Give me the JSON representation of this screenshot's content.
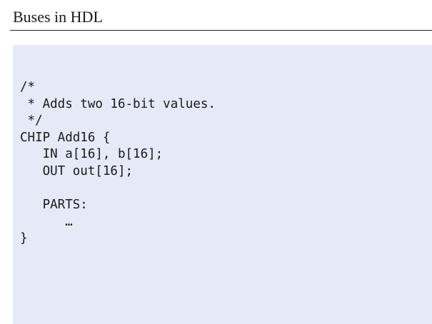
{
  "slide": {
    "title": "Buses in HDL"
  },
  "code": {
    "lines": [
      "/*",
      " * Adds two 16-bit values.",
      " */",
      "CHIP Add16 {",
      "   IN a[16], b[16];",
      "   OUT out[16];",
      "",
      "   PARTS:",
      "      …",
      "}"
    ]
  }
}
